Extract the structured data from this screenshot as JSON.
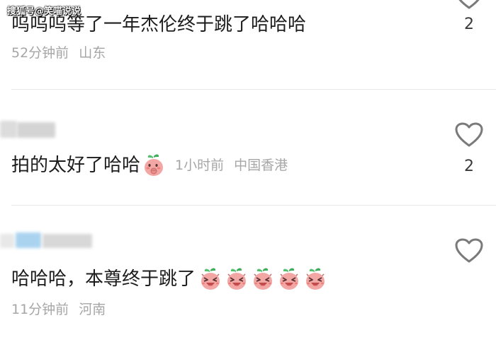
{
  "watermark": {
    "text": "搜狐号@笑喵说说"
  },
  "comments": [
    {
      "text": "呜呜呜等了一年杰伦终于跳了哈哈哈",
      "time": "52分钟前",
      "location": "山东",
      "likes": "2",
      "emojis": []
    },
    {
      "text": "拍的太好了哈哈",
      "time": "1小时前",
      "location": "中国香港",
      "likes": "2",
      "emojis": [
        "peach-thinking-emoji"
      ]
    },
    {
      "text": "哈哈哈，本尊终于跳了",
      "time": "11分钟前",
      "location": "河南",
      "likes": "",
      "emojis": [
        "peach-laughing-emoji",
        "peach-laughing-emoji",
        "peach-laughing-emoji",
        "peach-laughing-emoji",
        "peach-laughing-emoji"
      ]
    }
  ],
  "icons": {
    "like": "heart-outline-icon"
  },
  "colors": {
    "text": "#1c1c1c",
    "meta": "#a6a6a6",
    "divider": "#e8e8e8",
    "emoji_body": "#f3a7a4",
    "emoji_leaf": "#3fae5c"
  }
}
